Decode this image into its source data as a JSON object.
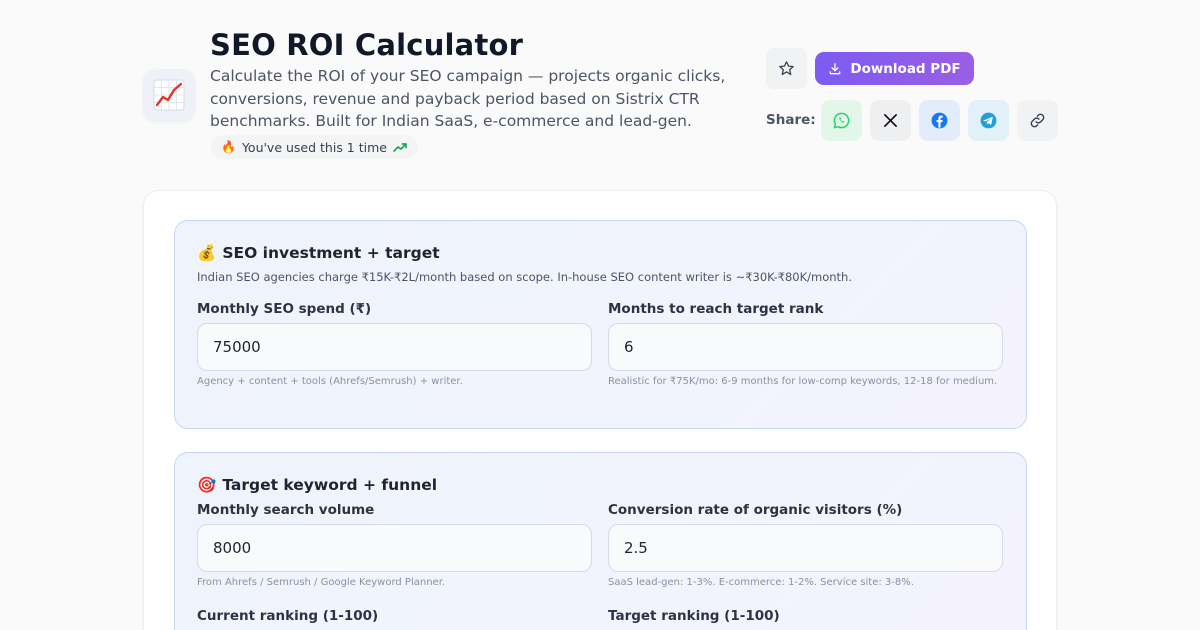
{
  "header": {
    "app_icon": "chart-increasing-emoji",
    "title": "SEO ROI Calculator",
    "subtitle": "Calculate the ROI of your SEO campaign — projects organic clicks, conversions, revenue and payback period based on Sistrix CTR benchmarks. Built for Indian SaaS, e-commerce and lead-gen.",
    "usage_emoji": "🔥",
    "usage_text": "You've used this 1 time",
    "usage_trend_icon": "trending-up-icon"
  },
  "actions": {
    "download_label": "Download PDF",
    "share_label": "Share:",
    "share_targets": [
      "whatsapp",
      "x",
      "facebook",
      "telegram",
      "copy-link"
    ]
  },
  "sections": [
    {
      "emoji": "💰",
      "title": "SEO investment + target",
      "description": "Indian SEO agencies charge ₹15K-₹2L/month based on scope. In-house SEO content writer is ~₹30K-₹80K/month.",
      "fields": [
        {
          "label": "Monthly SEO spend (₹)",
          "value": "75000",
          "hint": "Agency + content + tools (Ahrefs/Semrush) + writer."
        },
        {
          "label": "Months to reach target rank",
          "value": "6",
          "hint": "Realistic for ₹75K/mo: 6-9 months for low-comp keywords, 12-18 for medium."
        }
      ]
    },
    {
      "emoji": "🎯",
      "title": "Target keyword + funnel",
      "fields": [
        {
          "label": "Monthly search volume",
          "value": "8000",
          "hint": "From Ahrefs / Semrush / Google Keyword Planner."
        },
        {
          "label": "Conversion rate of organic visitors (%)",
          "value": "2.5",
          "hint": "SaaS lead-gen: 1-3%. E-commerce: 1-2%. Service site: 3-8%."
        },
        {
          "label": "Current ranking (1-100)"
        },
        {
          "label": "Target ranking (1-100)"
        }
      ]
    }
  ],
  "colors": {
    "accent_gradient_start": "#7c5cf2",
    "accent_gradient_end": "#9b5de5",
    "whatsapp": "#25d366",
    "facebook": "#1877f2",
    "telegram": "#229ed9"
  }
}
